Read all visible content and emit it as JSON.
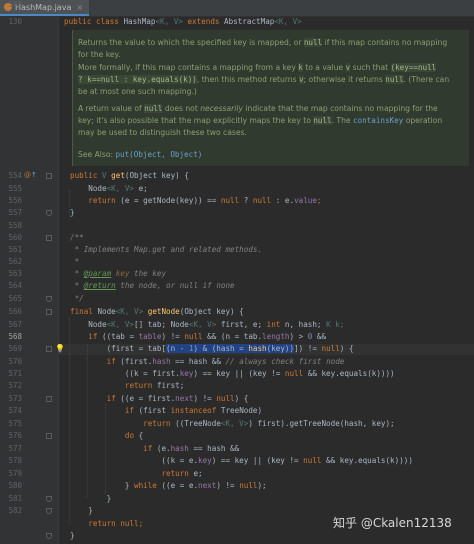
{
  "tab": {
    "title": "HashMap.java",
    "close": "×"
  },
  "gutter": {
    "line_numbers": [
      "130",
      "",
      "",
      "",
      "",
      "",
      "",
      "",
      "",
      "",
      "",
      "",
      "",
      "",
      "",
      "",
      "",
      "554",
      "555",
      "556",
      "557",
      "558",
      "",
      "560",
      "561",
      "562",
      "563",
      "564",
      "565",
      "566",
      "567",
      "568",
      "569",
      "570",
      "571",
      "572",
      "573",
      "574",
      "575",
      "576",
      "577",
      "578",
      "579",
      "580",
      "581",
      "582",
      "583"
    ],
    "override_icon": "@",
    "override_icon2": "↑",
    "bulb_icon": "💡"
  },
  "header_line": {
    "kw1": "public class ",
    "name": "HashMap",
    "gen1": "<K, V>",
    "kw2": " extends ",
    "parent": "AbstractMap",
    "gen2": "<K, V>"
  },
  "doc": {
    "p1a": "Returns the value to which the specified key is mapped, or",
    "p1code": "null",
    "p1b": "if this map contains no mapping",
    "p1c": "for the key.",
    "p2a": "More formally, if this map contains a mapping from a key",
    "p2k": "k",
    "p2b": "to a value",
    "p2v": "v",
    "p2c": "such that",
    "p2code": "(key==null",
    "p3code1": "? k==null : key.equals(k))",
    "p3a": ", then this method returns",
    "p3v": "v",
    "p3b": "; otherwise it returns",
    "p3null": "null",
    "p3c": ". (There can",
    "p4": "be at most one such mapping.)",
    "p5a": "A return value of",
    "p5null": "null",
    "p5b": "does not",
    "p5em": "necessarily",
    "p5c": "indicate that the map contains no mapping for the",
    "p6a": "key; it's also possible that the map explicitly maps the key to",
    "p6null": "null",
    "p6b": ". The",
    "p6link": "containsKey",
    "p6c": "operation",
    "p7": "may be used to distinguish these two cases.",
    "see_label": "See Also:",
    "see_link": "put(Object, Object)"
  },
  "code": {
    "l554a": "public ",
    "l554b": "V ",
    "l554c": "get",
    "l554d": "(Object key) {",
    "l555a": "    Node",
    "l555b": "<K, V>",
    "l555c": " e;",
    "l556a": "    return ",
    "l556b": "(e = getNode(key)) == ",
    "l556c": "null",
    "l556d": " ? ",
    "l556e": "null",
    "l556f": " : e.",
    "l556g": "value",
    "l556h": ";",
    "l557": "}",
    "l561": "/**",
    "l562": " * Implements Map.get and related methods.",
    "l563": " *",
    "l564a": " * ",
    "l564b": "@param",
    "l564c": " key",
    "l564d": " the key",
    "l565a": " * ",
    "l565b": "@return",
    "l565c": " the node, or null if none",
    "l566": " */",
    "l567a": "final ",
    "l567b": "Node",
    "l567c": "<K, V>",
    "l567d": " getNode",
    "l567e": "(Object key) {",
    "l568a": "    Node",
    "l568b": "<K, V>",
    "l568c": "[] tab; Node",
    "l568d": "<K, V>",
    "l568e": " first, e; ",
    "l568f": "int ",
    "l568g": "n, hash; ",
    "l568h": "K k;",
    "l569a": "    ",
    "l569b": "if ",
    "l569c": "((tab = ",
    "l569d": "table",
    "l569e": ") != ",
    "l569f": "null ",
    "l569g": "&& (n = tab.",
    "l569h": "length",
    "l569i": ") > ",
    "l569j": "0",
    "l569k": " &&",
    "l570a": "        (first = tab[",
    "l570b": "(n - ",
    "l570c": "1",
    "l570d": ") & (hash = ",
    "l570e": "hash",
    "l570f": "(key))",
    "l570g": "]) != ",
    "l570h": "null",
    "l570i": ") {",
    "l571a": "        ",
    "l571b": "if ",
    "l571c": "(first.",
    "l571d": "hash",
    "l571e": " == hash && ",
    "l571f": "// always check first node",
    "l572a": "            ((k = first.",
    "l572b": "key",
    "l572c": ") == key || (key != ",
    "l572d": "null",
    "l572e": " && key.equals(k))))",
    "l573a": "            ",
    "l573b": "return ",
    "l573c": "first;",
    "l574a": "        ",
    "l574b": "if ",
    "l574c": "((e = first.",
    "l574d": "next",
    "l574e": ") != ",
    "l574f": "null",
    "l574g": ") {",
    "l575a": "            ",
    "l575b": "if ",
    "l575c": "(first ",
    "l575d": "instanceof ",
    "l575e": "TreeNode)",
    "l576a": "                ",
    "l576b": "return ",
    "l576c": "((TreeNode",
    "l576d": "<K, V>",
    "l576e": ") first).getTreeNode(hash, key);",
    "l577a": "            ",
    "l577b": "do ",
    "l577c": "{",
    "l578a": "                ",
    "l578b": "if ",
    "l578c": "(e.",
    "l578d": "hash",
    "l578e": " == hash &&",
    "l579a": "                    ((k = e.",
    "l579b": "key",
    "l579c": ") == key || (key != ",
    "l579d": "null",
    "l579e": " && key.equals(k))))",
    "l580a": "                    ",
    "l580b": "return ",
    "l580c": "e;",
    "l581a": "            } ",
    "l581b": "while ",
    "l581c": "((e = e.",
    "l581d": "next",
    "l581e": ") != ",
    "l581f": "null",
    "l581g": ");",
    "l582": "        }",
    "l583": "    }",
    "l584a": "    ",
    "l584b": "return ",
    "l584c": "null",
    "l584d": ";",
    "l585": "}"
  },
  "watermark": "知乎 @Ckalen12138",
  "colors": {
    "background": "#2b2b2b",
    "keyword": "#cc7832",
    "method": "#ffc66d",
    "field": "#9876aa",
    "number": "#6897bb",
    "doc_text": "#8c9f74"
  }
}
